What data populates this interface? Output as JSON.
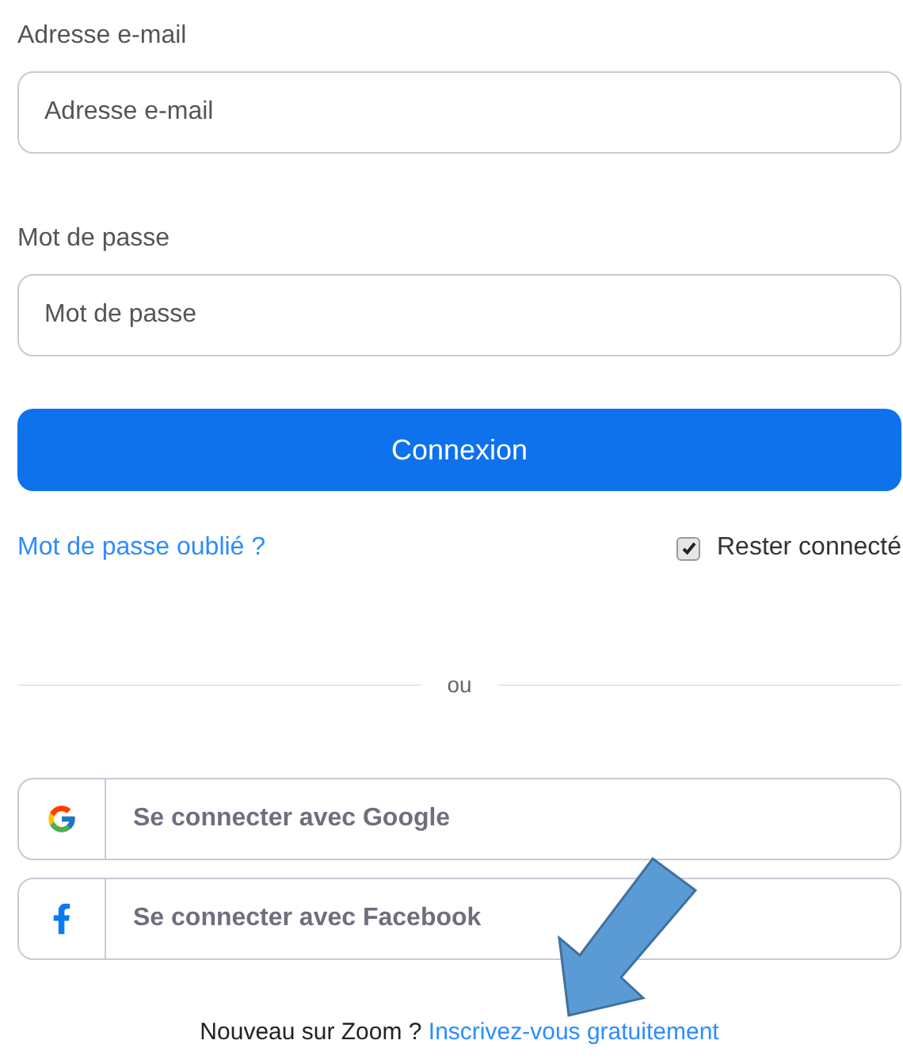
{
  "email": {
    "label": "Adresse e-mail",
    "placeholder": "Adresse e-mail"
  },
  "password": {
    "label": "Mot de passe",
    "placeholder": "Mot de passe"
  },
  "submit_button": "Connexion",
  "forgot_link": "Mot de passe oublié ?",
  "remember": {
    "label": "Rester connecté",
    "checked": true
  },
  "divider": "ou",
  "social_buttons": [
    {
      "kind": "google",
      "label": "Se connecter avec Google"
    },
    {
      "kind": "facebook",
      "label": "Se connecter avec Facebook"
    }
  ],
  "footer": {
    "text": "Nouveau sur Zoom ?",
    "link": "Inscrivez-vous gratuitement"
  }
}
